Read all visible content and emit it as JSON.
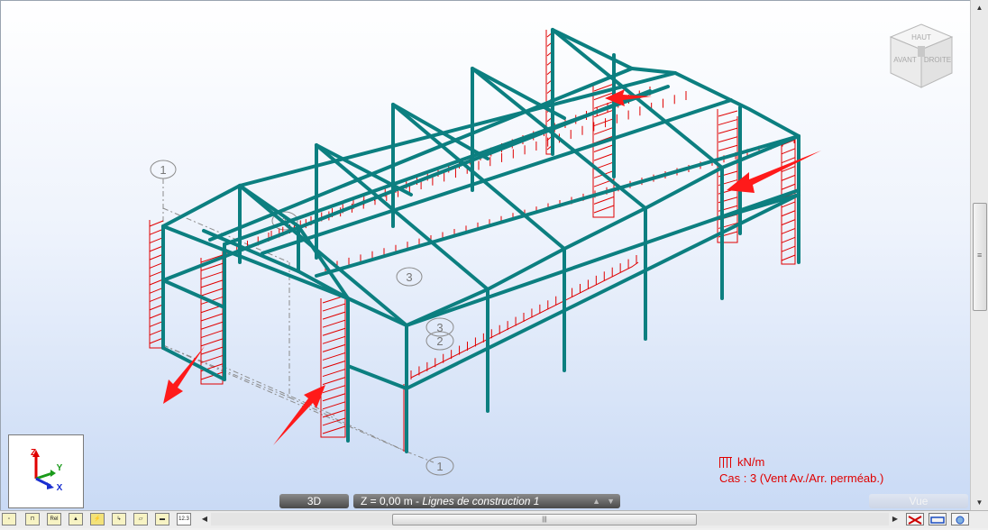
{
  "view": {
    "mode_label": "3D",
    "level_label": "Z = 0,00 m",
    "level_separator": " - ",
    "level_description": "Lignes de construction 1",
    "vue_label": "Vue"
  },
  "legend": {
    "unit": "kN/m",
    "case": "Cas : 3 (Vent Av./Arr. perméab.)"
  },
  "gizmo": {
    "z": "Z",
    "y": "Y",
    "x": "X"
  },
  "view_cube": {
    "top": "HAUT",
    "front": "AVANT",
    "right": "DROITE"
  },
  "grid_labels": {
    "a": "1",
    "b": "1",
    "c": "2",
    "d": "3",
    "e": "3",
    "f": "1"
  },
  "toolbar_icons": [
    "node-icon",
    "section-icon",
    "release-icon",
    "support-icon",
    "load-icon",
    "member-icon",
    "panel-icon",
    "slab-icon",
    "numbering-icon"
  ],
  "toolbar_texts": {
    "release": "Rel",
    "numbering": "12.3"
  },
  "colors": {
    "structure": "#0c7f80",
    "loads": "#e00000",
    "arrows": "#ff1a1a",
    "background_top": "#ffffff",
    "background_bottom": "#c9daf5"
  }
}
